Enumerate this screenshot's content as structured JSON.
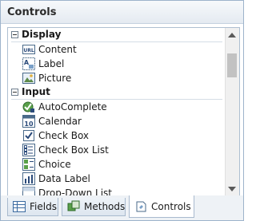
{
  "panel": {
    "title": "Controls"
  },
  "groups": [
    {
      "label": "Display",
      "items": [
        {
          "label": "Content",
          "icon": "url-content-icon"
        },
        {
          "label": "Label",
          "icon": "label-icon"
        },
        {
          "label": "Picture",
          "icon": "picture-icon"
        }
      ]
    },
    {
      "label": "Input",
      "items": [
        {
          "label": "AutoComplete",
          "icon": "autocomplete-icon"
        },
        {
          "label": "Calendar",
          "icon": "calendar-icon"
        },
        {
          "label": "Check Box",
          "icon": "checkbox-icon"
        },
        {
          "label": "Check Box List",
          "icon": "checkbox-list-icon"
        },
        {
          "label": "Choice",
          "icon": "choice-icon"
        },
        {
          "label": "Data Label",
          "icon": "data-label-icon"
        },
        {
          "label": "Drop-Down List",
          "icon": "dropdown-list-icon"
        }
      ]
    }
  ],
  "tabs": [
    {
      "label": "Fields",
      "icon": "fields-icon"
    },
    {
      "label": "Methods",
      "icon": "methods-icon"
    },
    {
      "label": "Controls",
      "icon": "controls-icon"
    }
  ],
  "colors": {
    "accent": "#9db3cb",
    "header_bg": "#e4eaf1",
    "active_tab": "#ffffff"
  }
}
